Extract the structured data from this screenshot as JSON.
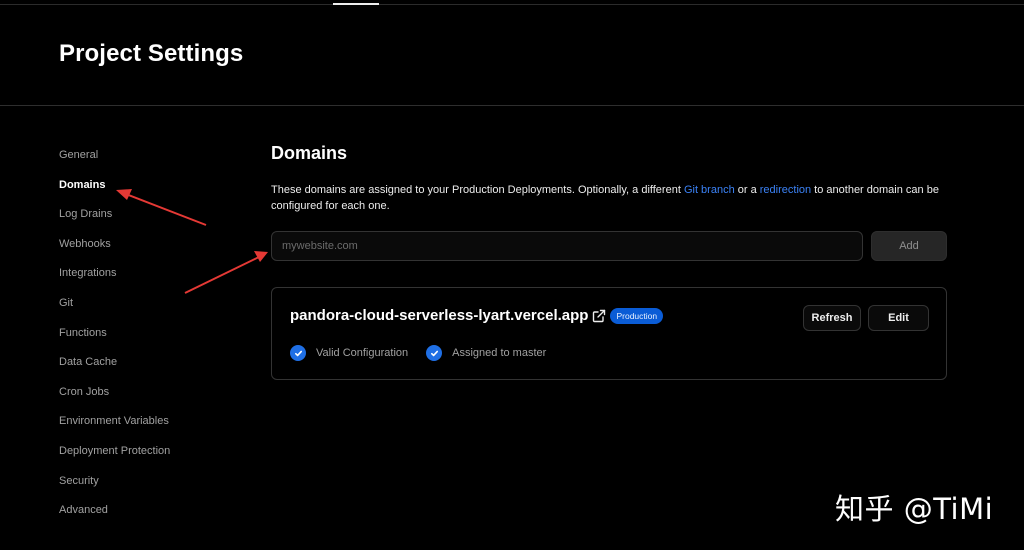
{
  "header": {
    "title": "Project Settings"
  },
  "sidebar": {
    "items": [
      {
        "label": "General"
      },
      {
        "label": "Domains",
        "active": true
      },
      {
        "label": "Log Drains"
      },
      {
        "label": "Webhooks"
      },
      {
        "label": "Integrations"
      },
      {
        "label": "Git"
      },
      {
        "label": "Functions"
      },
      {
        "label": "Data Cache"
      },
      {
        "label": "Cron Jobs"
      },
      {
        "label": "Environment Variables"
      },
      {
        "label": "Deployment Protection"
      },
      {
        "label": "Security"
      },
      {
        "label": "Advanced"
      }
    ]
  },
  "domains": {
    "title": "Domains",
    "description": {
      "part1": "These domains are assigned to your Production Deployments. Optionally, a different ",
      "link1": "Git branch",
      "part2": " or a ",
      "link2": "redirection",
      "part3": " to another domain can be configured for each one."
    },
    "input": {
      "placeholder": "mywebsite.com",
      "value": ""
    },
    "add_label": "Add",
    "card": {
      "domain": "pandora-cloud-serverless-lyart.vercel.app",
      "badge": "Production",
      "refresh_label": "Refresh",
      "edit_label": "Edit",
      "status": [
        {
          "label": "Valid Configuration",
          "icon": "check-circle-icon"
        },
        {
          "label": "Assigned to master",
          "icon": "check-circle-icon"
        }
      ]
    }
  },
  "watermark": "知乎 @TiMi",
  "colors": {
    "background": "#000000",
    "accent_link": "#3b82f6",
    "badge": "#0a5cd6",
    "check": "#1f6fe5",
    "annotation_arrow": "#e53935"
  }
}
